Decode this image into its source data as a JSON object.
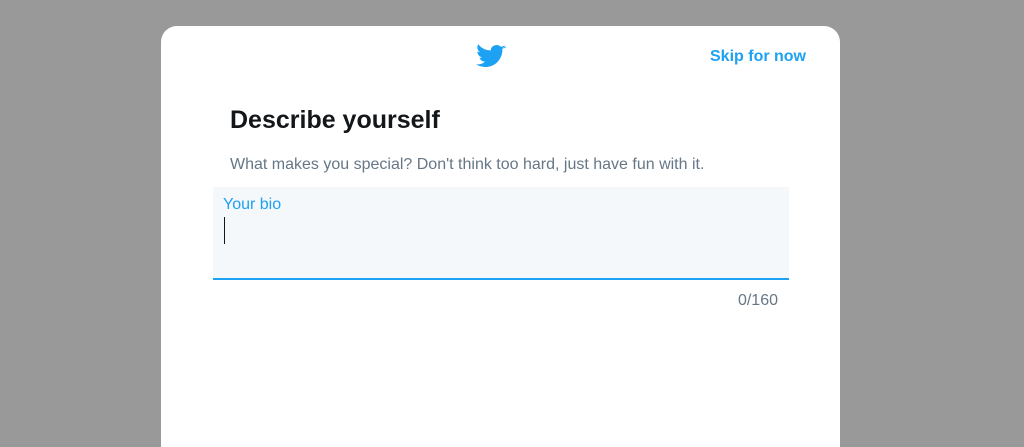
{
  "header": {
    "logo_icon": "twitter-bird-icon",
    "skip_label": "Skip for now"
  },
  "main": {
    "title": "Describe yourself",
    "subtitle": "What makes you special? Don't think too hard, just have fun with it."
  },
  "bio_field": {
    "label": "Your bio",
    "value": "",
    "counter": "0/160"
  },
  "colors": {
    "accent": "#1da1f2",
    "backdrop": "#999999",
    "field_background": "#f5f8fa",
    "title_text": "#14171a",
    "secondary_text": "#657786"
  }
}
